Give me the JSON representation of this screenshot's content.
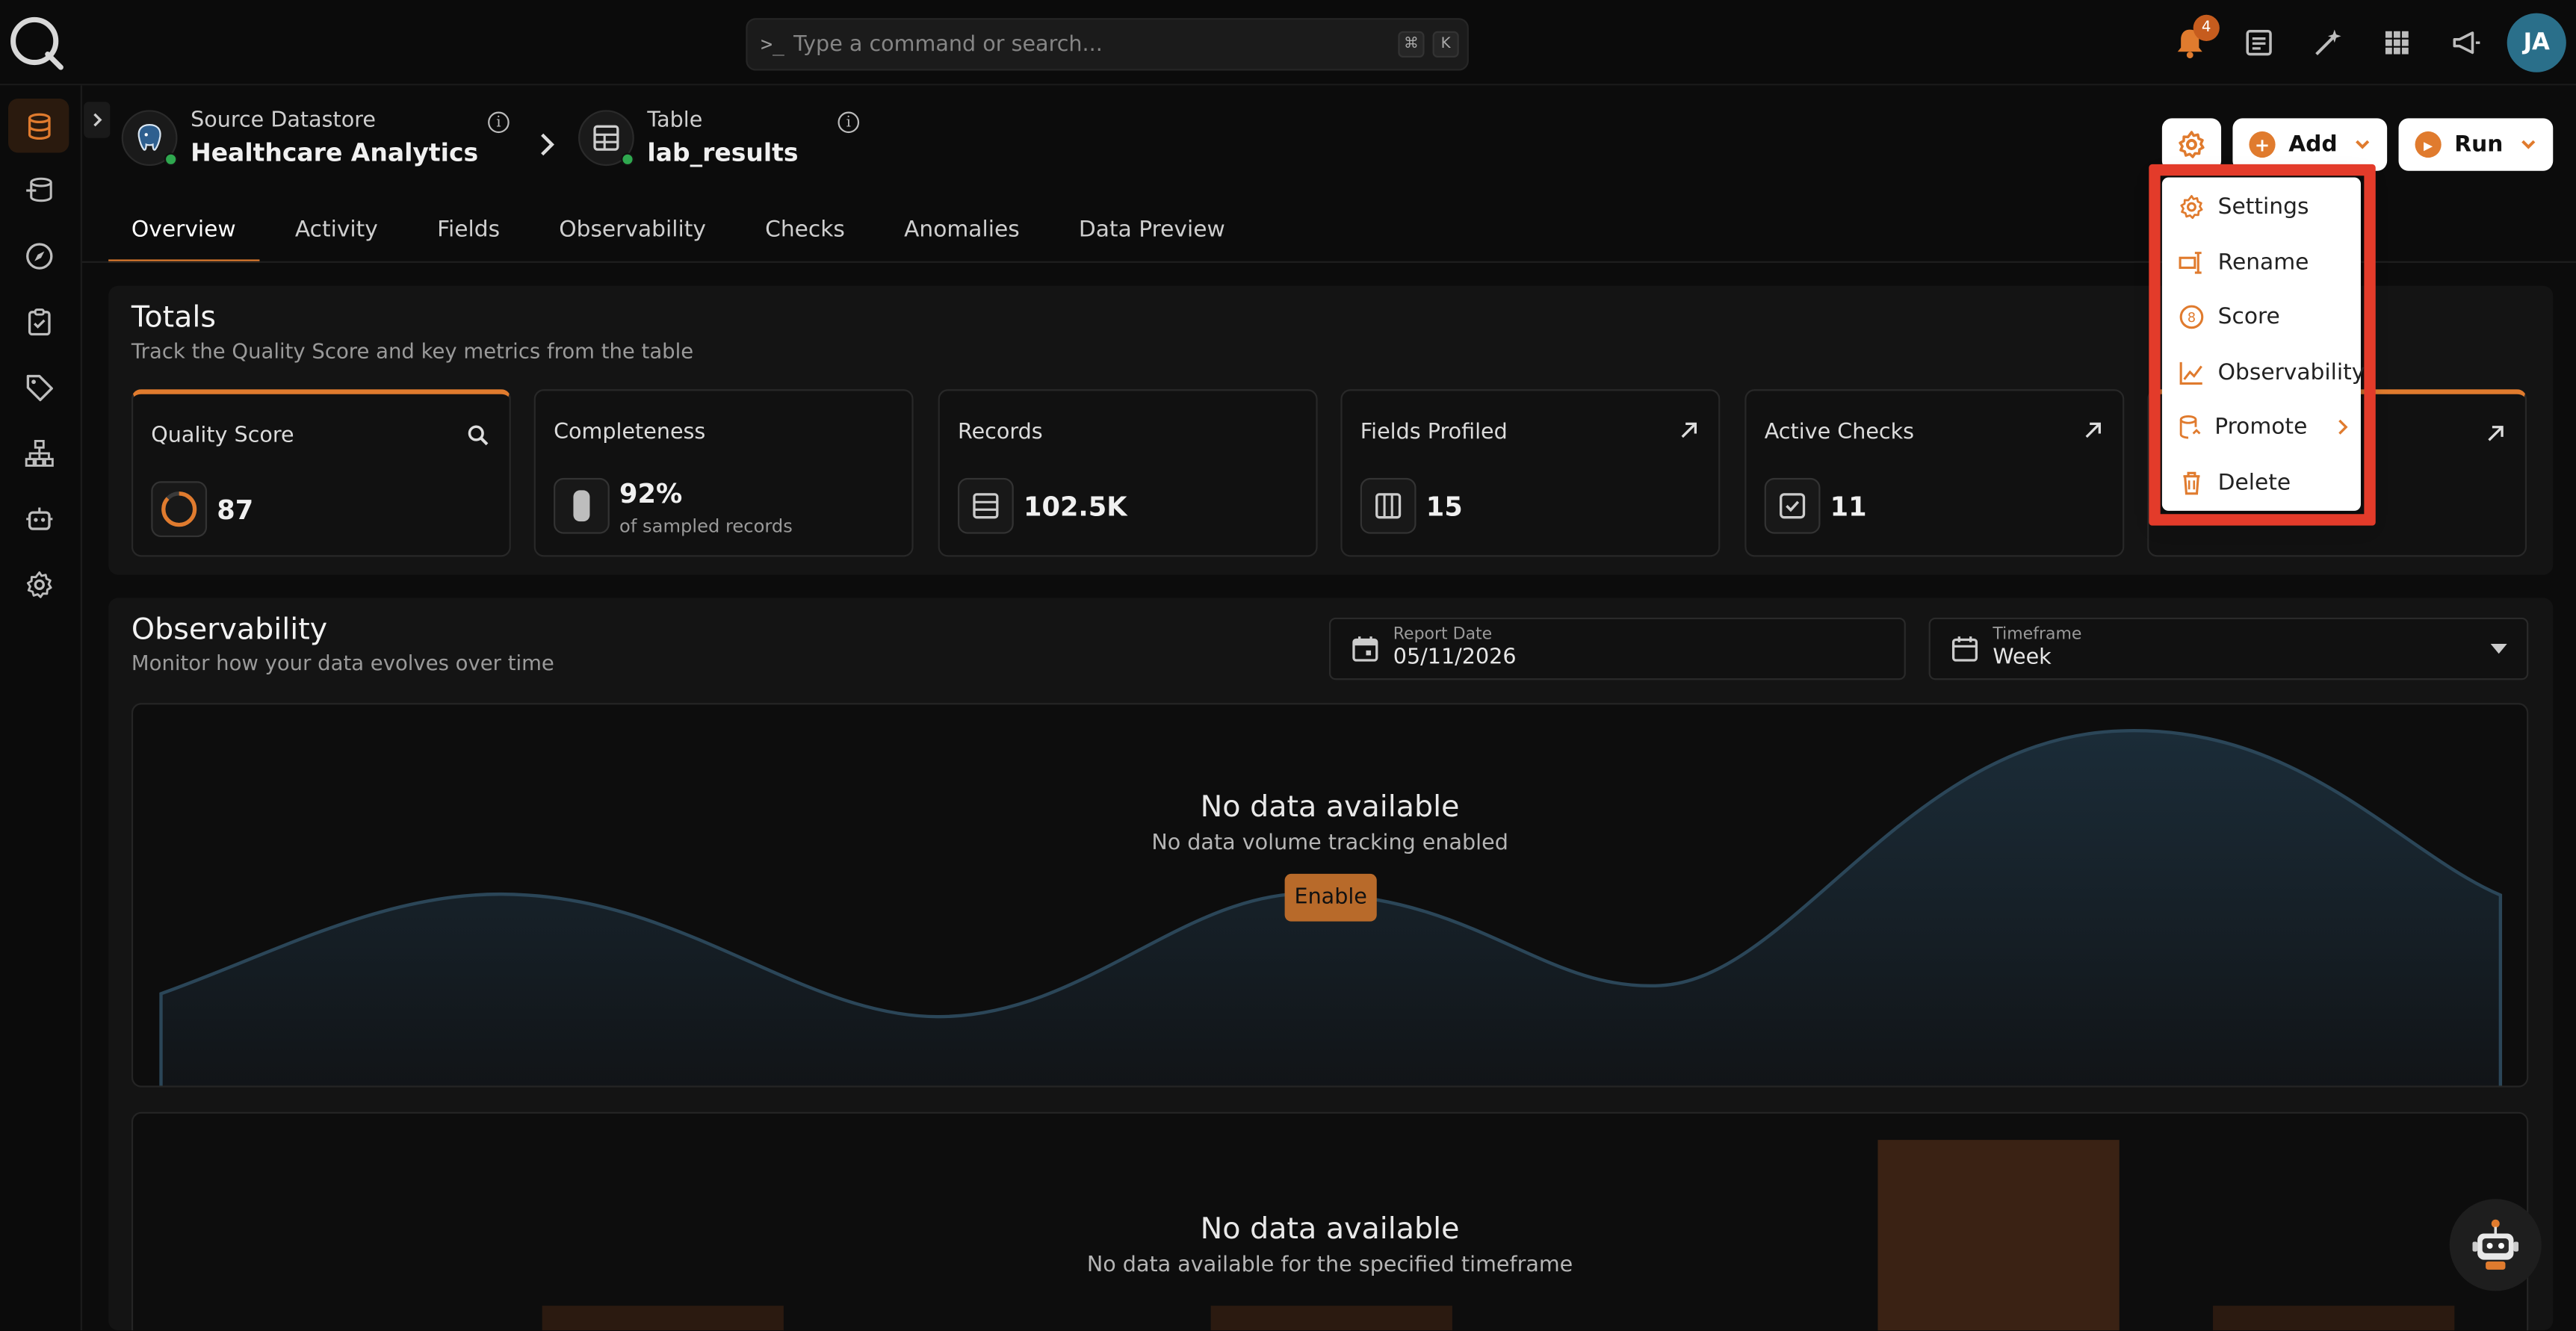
{
  "search": {
    "placeholder": "Type a command or search...",
    "kbd1": "⌘",
    "kbd2": "K"
  },
  "notifications": {
    "count": "4"
  },
  "user": {
    "initials": "JA"
  },
  "breadcrumb": {
    "source_label": "Source Datastore",
    "source_value": "Healthcare Analytics",
    "table_label": "Table",
    "table_value": "lab_results"
  },
  "actions": {
    "add": "Add",
    "run": "Run"
  },
  "tabs": [
    "Overview",
    "Activity",
    "Fields",
    "Observability",
    "Checks",
    "Anomalies",
    "Data Preview"
  ],
  "totals": {
    "title": "Totals",
    "subtitle": "Track the Quality Score and key metrics from the table",
    "cards": [
      {
        "title": "Quality Score",
        "value": "87"
      },
      {
        "title": "Completeness",
        "value": "92%",
        "sub": "of sampled records"
      },
      {
        "title": "Records",
        "value": "102.5K"
      },
      {
        "title": "Fields Profiled",
        "value": "15"
      },
      {
        "title": "Active Checks",
        "value": "11"
      }
    ]
  },
  "observability": {
    "title": "Observability",
    "subtitle": "Monitor how your data evolves over time",
    "report_date_label": "Report Date",
    "report_date": "05/11/2026",
    "timeframe_label": "Timeframe",
    "timeframe": "Week",
    "chart1": {
      "title": "No data available",
      "sub": "No data volume tracking enabled",
      "button": "Enable"
    },
    "chart2": {
      "title": "No data available",
      "sub": "No data available for the specified timeframe"
    }
  },
  "menu": {
    "items": [
      "Settings",
      "Rename",
      "Score",
      "Observability",
      "Promote",
      "Delete"
    ]
  },
  "colors": {
    "accent": "#e07b2e",
    "highlight": "#e33b2a",
    "background": "#0c0c0c"
  }
}
